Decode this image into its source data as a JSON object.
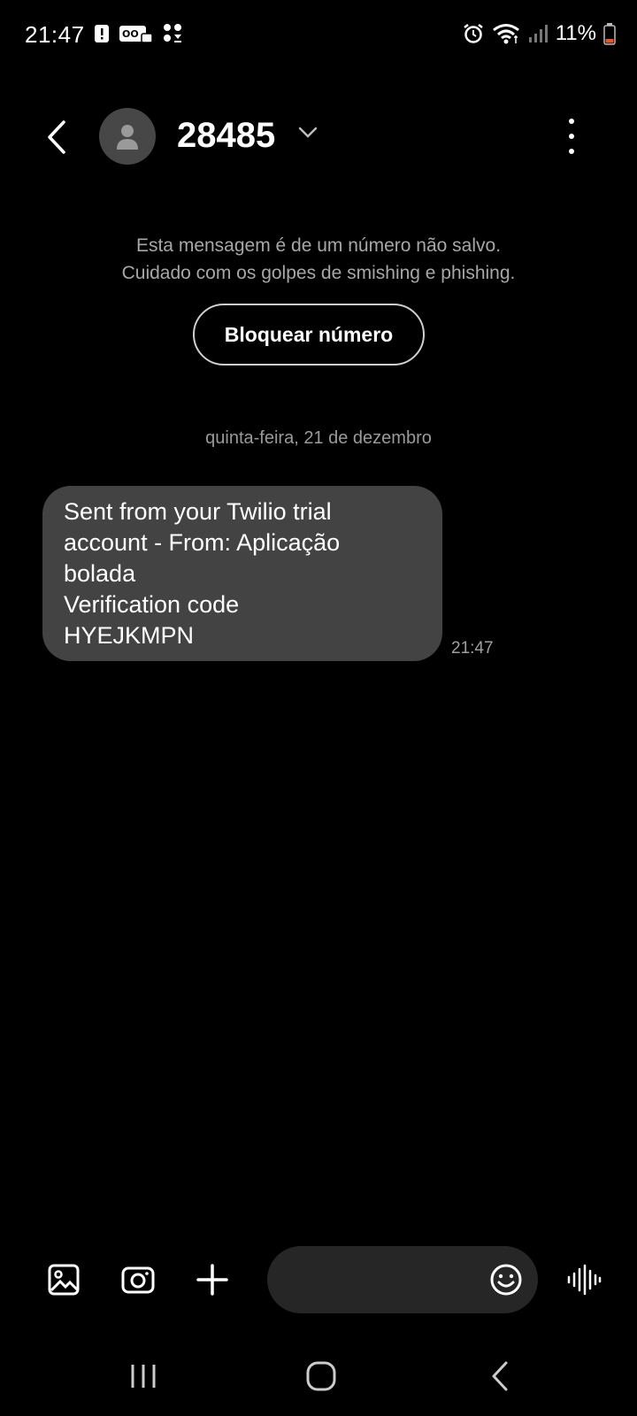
{
  "status_bar": {
    "time": "21:47",
    "battery": "11%",
    "icons_left": [
      "alert-icon",
      "voicemail-icon",
      "dots-icon"
    ],
    "icons_right": [
      "alarm-icon",
      "wifi-icon",
      "signal-icon",
      "battery-icon"
    ]
  },
  "header": {
    "contact": "28485",
    "back_icon": "chevron-left-icon",
    "menu_icon": "more-vert-icon"
  },
  "warning": {
    "line1": "Esta mensagem é de um número não salvo.",
    "line2": "Cuidado com os golpes de smishing e phishing.",
    "block_label": "Bloquear número"
  },
  "conversation": {
    "date": "quinta-feira, 21 de dezembro",
    "messages": [
      {
        "lines": [
          "Sent from your Twilio trial",
          "account - From: Aplicação",
          "bolada",
          "Verification code",
          "HYEJKMPN"
        ],
        "time": "21:47"
      }
    ]
  },
  "composer": {
    "tools": [
      "gallery-icon",
      "camera-icon",
      "plus-icon"
    ],
    "emoji_icon": "emoji-icon",
    "voice_icon": "voice-icon"
  },
  "colors": {
    "background": "#000000",
    "bubble": "#434343",
    "input": "#262626",
    "battery_low": "#e8552b"
  }
}
